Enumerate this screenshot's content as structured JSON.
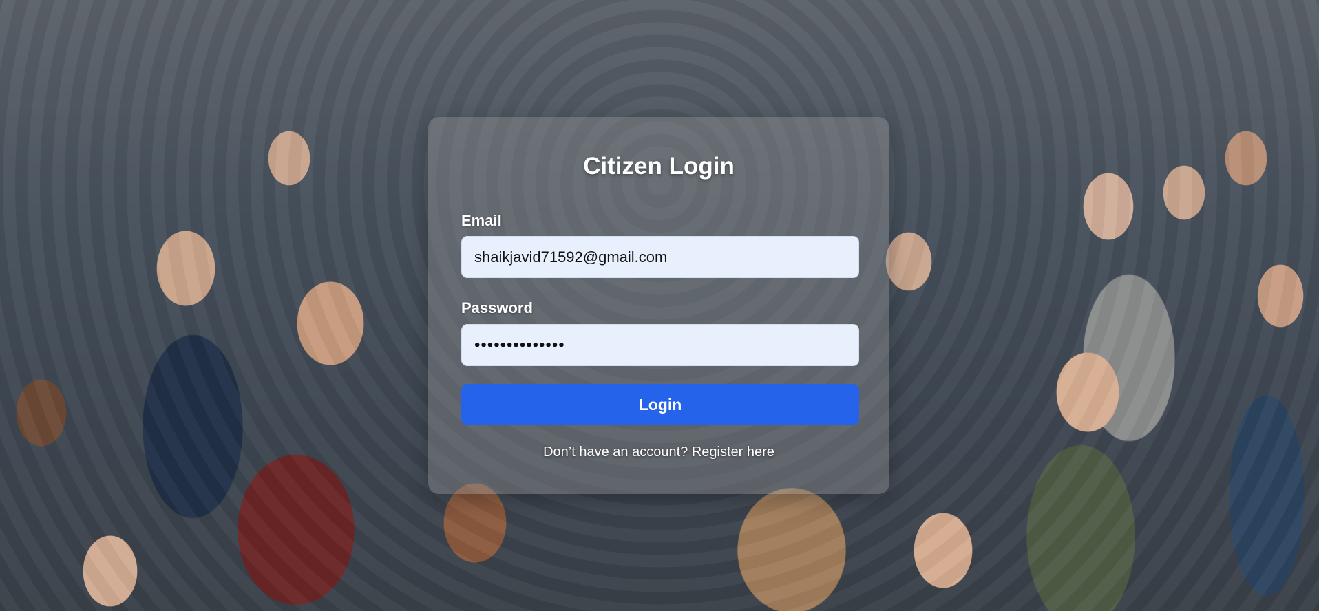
{
  "login": {
    "title": "Citizen Login",
    "email_label": "Email",
    "email_value": "shaikjavid71592@gmail.com",
    "password_label": "Password",
    "password_value": "••••••••••••••",
    "login_button": "Login",
    "register_prompt": "Don’t have an account?",
    "register_link": "Register here"
  },
  "colors": {
    "accent": "#2563eb",
    "input_bg": "#e8f0fe"
  }
}
